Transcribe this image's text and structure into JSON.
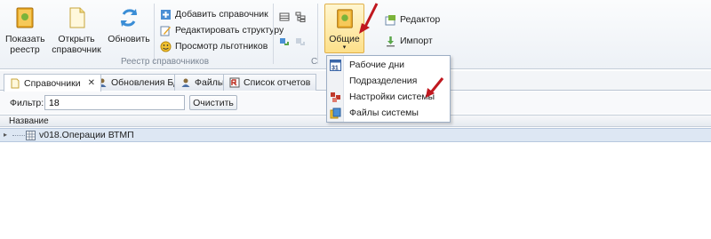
{
  "ribbon": {
    "show_registry": "Показать\nреестр",
    "open_ref": "Открыть\nсправочник",
    "refresh": "Обновить",
    "add_ref": "Добавить справочник",
    "edit_struct": "Редактировать структуру",
    "view_benefits": "Просмотр льготников",
    "group_registry": "Реестр справочников",
    "group_common_partial": "С",
    "common": "Общие",
    "editor": "Редактор",
    "import": "Импорт"
  },
  "menu": {
    "items": [
      "Рабочие дни",
      "Подразделения",
      "Настройки системы",
      "Файлы системы"
    ]
  },
  "tabs": [
    "Справочники",
    "Обновления БД",
    "Файлы",
    "Список отчетов"
  ],
  "filter": {
    "label": "Фильтр:",
    "value": "18",
    "clear": "Очистить"
  },
  "grid": {
    "header": "Название",
    "rows": [
      "v018.Операции ВТМП"
    ]
  }
}
